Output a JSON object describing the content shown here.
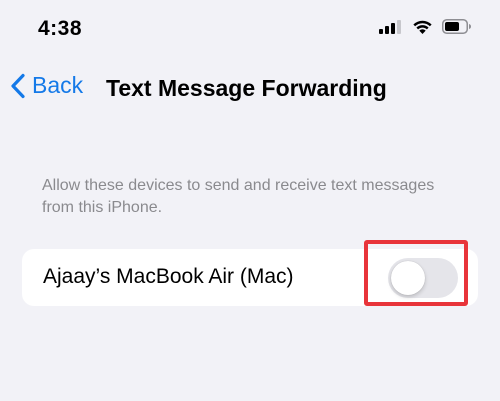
{
  "status_bar": {
    "time": "4:38",
    "icons": [
      "cellular-signal-icon",
      "wifi-icon",
      "battery-icon"
    ]
  },
  "nav": {
    "back_label": "Back",
    "title": "Text Message Forwarding"
  },
  "section": {
    "footer_text": "Allow these devices to send and receive text messages from this iPhone."
  },
  "devices": [
    {
      "label": "Ajaay’s MacBook Air (Mac)",
      "enabled": false
    }
  ],
  "colors": {
    "accent": "#1479e8",
    "background": "#f2f2f7",
    "secondary_text": "#8a8a8e",
    "toggle_off": "#e5e5ea",
    "highlight": "#e8343a"
  }
}
